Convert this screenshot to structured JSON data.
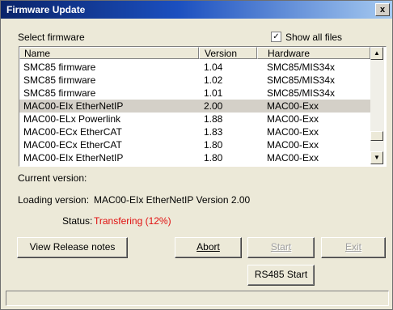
{
  "window": {
    "title": "Firmware Update",
    "close_label": "x"
  },
  "select_label": "Select firmware",
  "show_all": {
    "label": "Show all files",
    "checked_mark": "✓"
  },
  "table": {
    "headers": [
      "Name",
      "Version",
      "Hardware"
    ],
    "rows": [
      {
        "name": "SMC85 firmware",
        "version": "1.04",
        "hardware": "SMC85/MIS34x"
      },
      {
        "name": "SMC85 firmware",
        "version": "1.02",
        "hardware": "SMC85/MIS34x"
      },
      {
        "name": "SMC85 firmware",
        "version": "1.01",
        "hardware": "SMC85/MIS34x"
      },
      {
        "name": "MAC00-EIx EtherNetIP",
        "version": "2.00",
        "hardware": "MAC00-Exx"
      },
      {
        "name": "MAC00-ELx Powerlink",
        "version": "1.88",
        "hardware": "MAC00-Exx"
      },
      {
        "name": "MAC00-ECx EtherCAT",
        "version": "1.83",
        "hardware": "MAC00-Exx"
      },
      {
        "name": "MAC00-ECx EtherCAT",
        "version": "1.80",
        "hardware": "MAC00-Exx"
      },
      {
        "name": "MAC00-EIx EtherNetIP",
        "version": "1.80",
        "hardware": "MAC00-Exx"
      }
    ]
  },
  "scroll": {
    "up": "▲",
    "down": "▼"
  },
  "current_version_label": "Current version:",
  "loading": {
    "label": "Loading version:",
    "value": "MAC00-EIx EtherNetIP Version 2.00"
  },
  "status": {
    "label": "Status:",
    "value": "Transfering (12%)",
    "color": "#e01010"
  },
  "buttons": {
    "release_notes": "View Release notes",
    "abort": "Abort",
    "start": "Start",
    "exit": "Exit",
    "rs485": "RS485 Start"
  }
}
